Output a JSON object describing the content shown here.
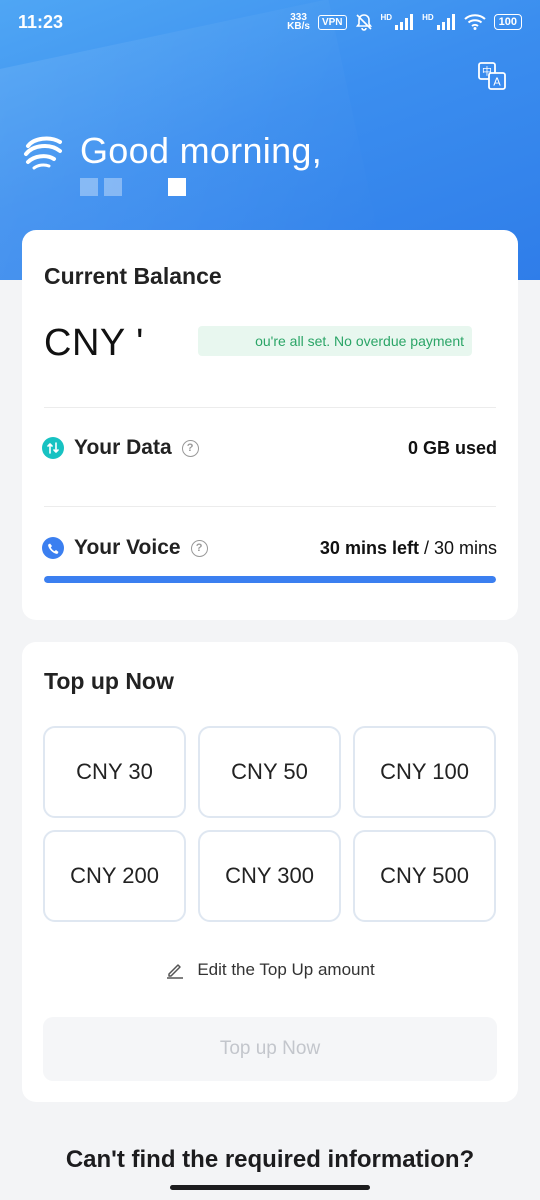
{
  "status_bar": {
    "time": "11:23",
    "net_speed_value": "333",
    "net_speed_unit": "KB/s",
    "vpn": "VPN",
    "signal1_label": "HD",
    "signal2_label": "HD",
    "battery": "100",
    "icons": [
      "mute-bell-icon",
      "signal-icon",
      "signal-icon",
      "wifi-icon",
      "battery-icon"
    ]
  },
  "header": {
    "greeting": "Good morning,",
    "translate_icon": "translate-icon",
    "logo_icon": "carrier-logo-icon"
  },
  "balance": {
    "title": "Current Balance",
    "amount": "CNY '",
    "payment_status": "ou're all set. No overdue payment"
  },
  "data_row": {
    "label": "Your Data",
    "value": "0 GB used",
    "icon": "data-transfer-icon"
  },
  "voice_row": {
    "label": "Your Voice",
    "value_bold": "30 mins left",
    "value_rest": " / 30 mins",
    "icon": "phone-icon",
    "progress_fraction": 1.0
  },
  "topup": {
    "title": "Top up Now",
    "amounts": [
      "CNY 30",
      "CNY 50",
      "CNY 100",
      "CNY 200",
      "CNY 300",
      "CNY 500"
    ],
    "edit_label": "Edit the Top Up amount",
    "submit_label": "Top up Now"
  },
  "help": {
    "heading": "Can't find the required information?"
  },
  "colors": {
    "accent": "#3b7ff0",
    "header_gradient_start": "#4fa6f4",
    "header_gradient_end": "#2f7de9",
    "success_text": "#2ba567",
    "data_icon": "#17c2c2"
  }
}
